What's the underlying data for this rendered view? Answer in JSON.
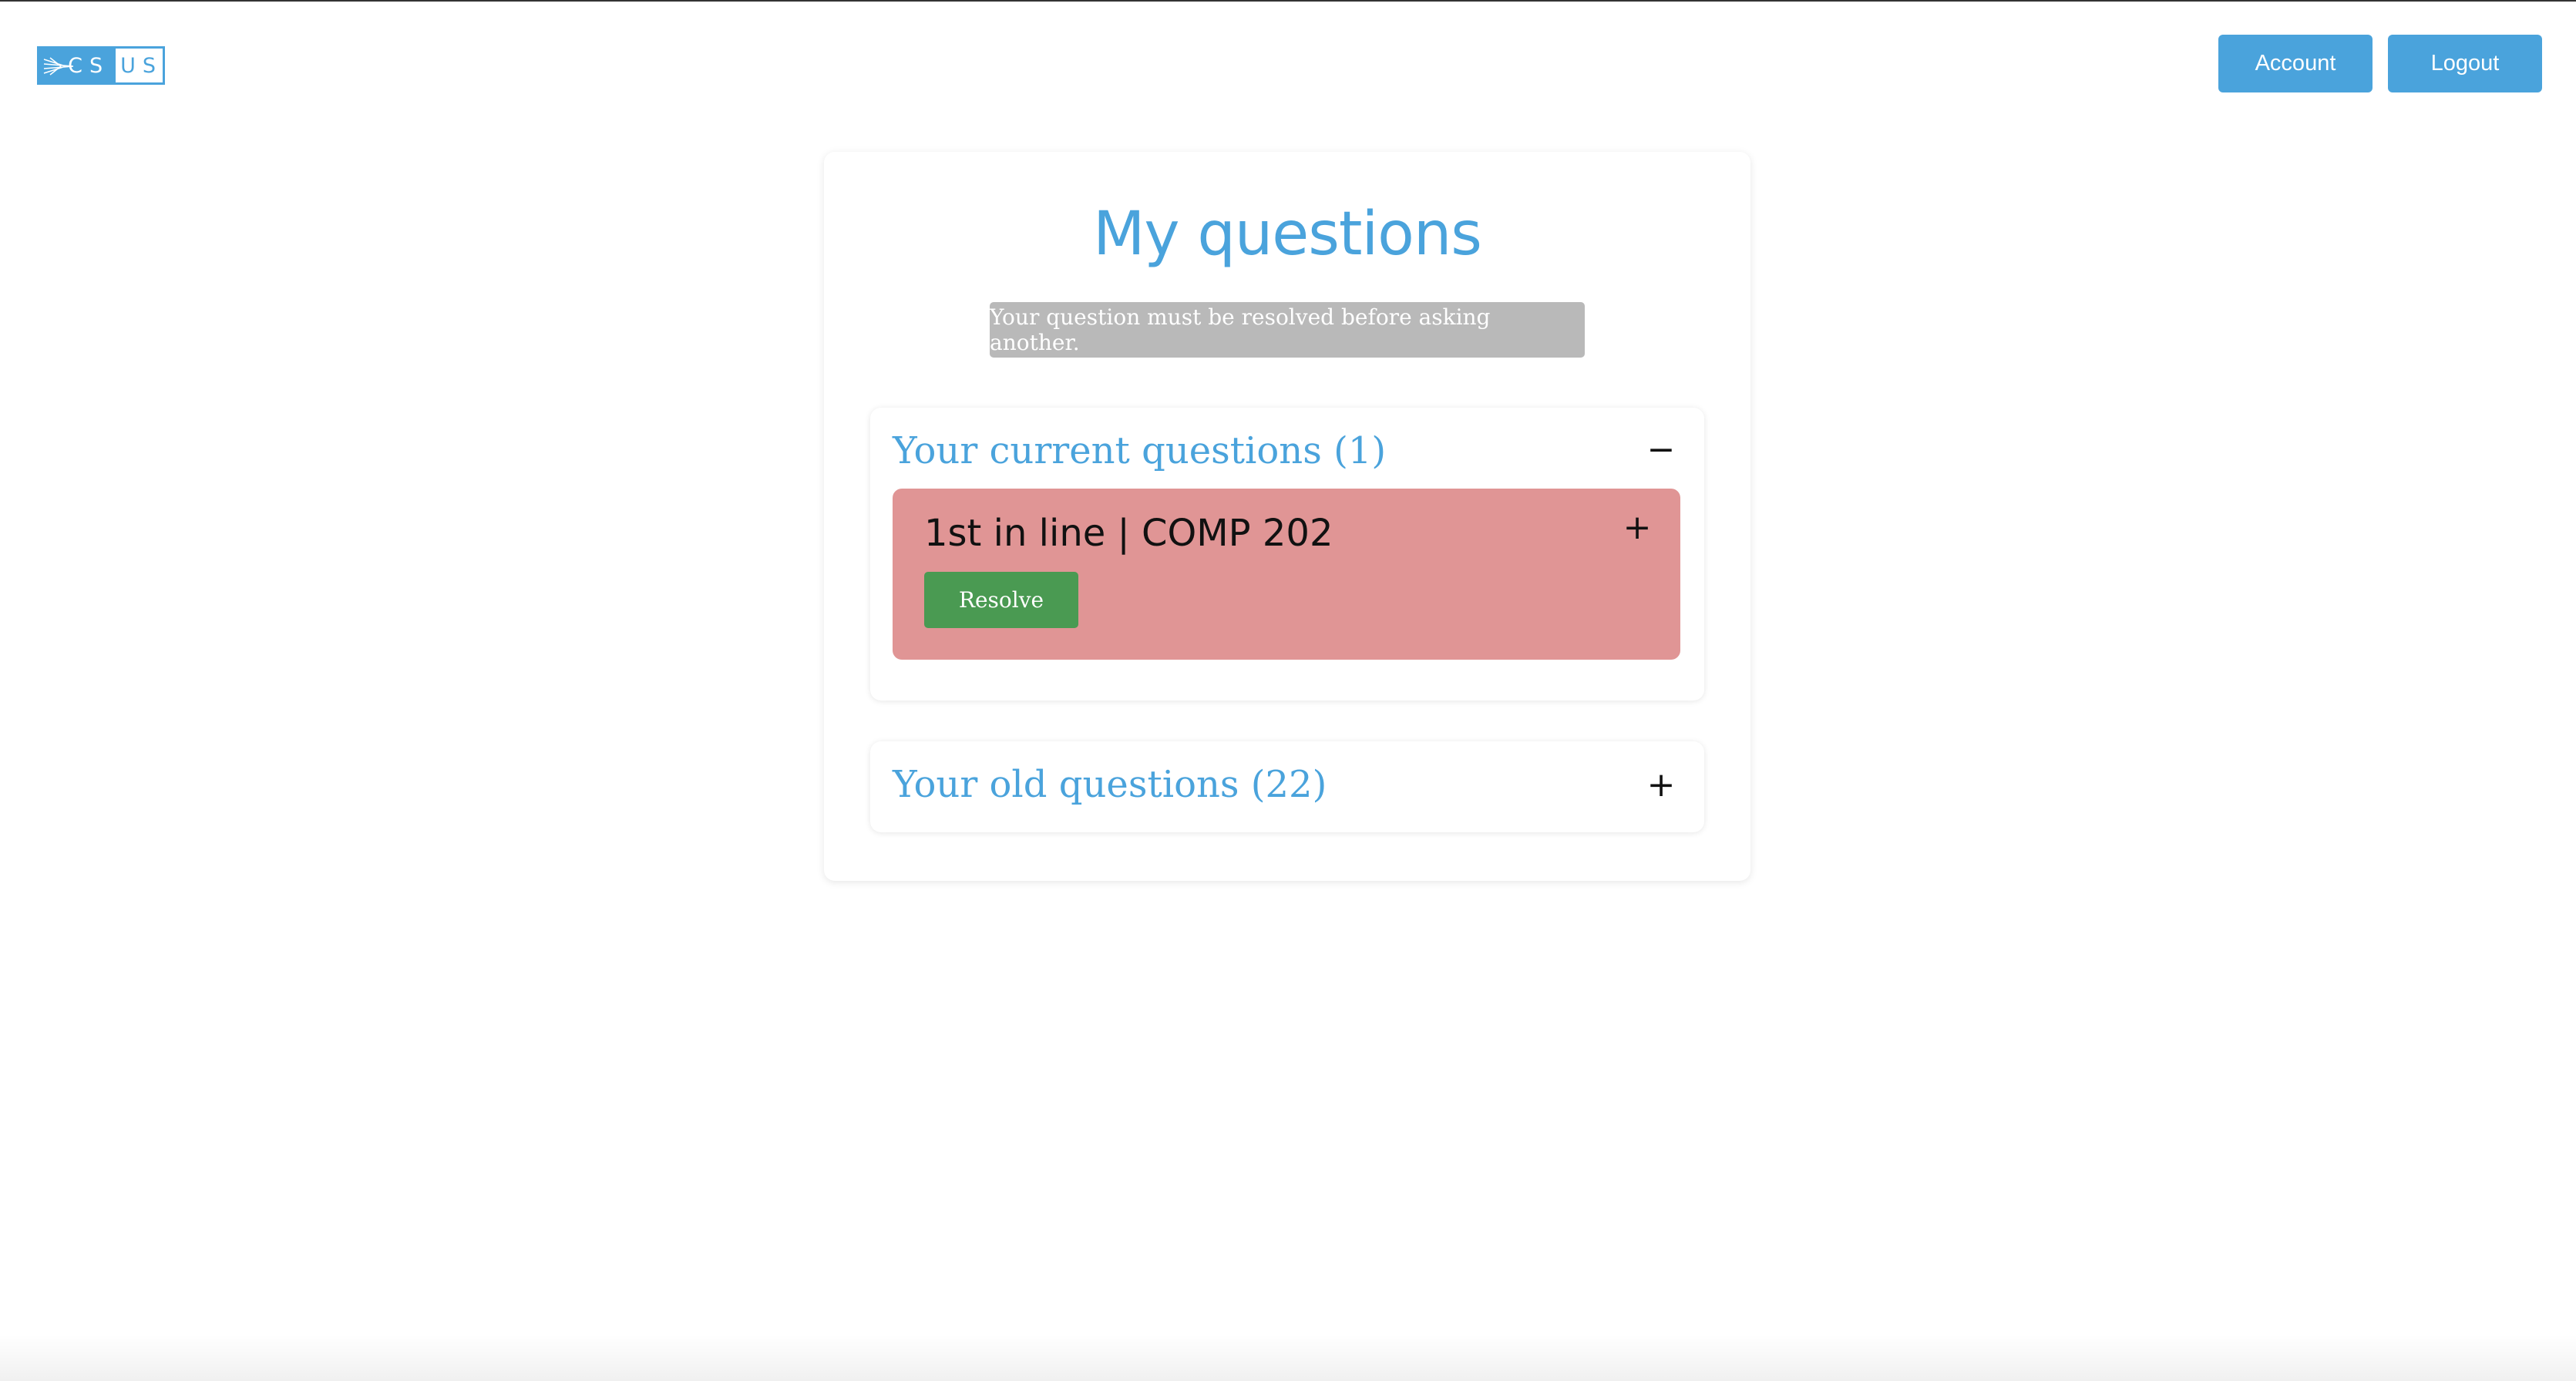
{
  "header": {
    "logo_text_left": "CS",
    "logo_text_right": "US",
    "account_label": "Account",
    "logout_label": "Logout"
  },
  "main": {
    "title": "My questions",
    "notice": "Your question must be resolved before asking another.",
    "current_panel": {
      "title": "Your current questions (1)",
      "toggle_icon": "−",
      "expanded": true,
      "items": [
        {
          "title": "1st in line | COMP 202",
          "expand_icon": "+",
          "resolve_label": "Resolve"
        }
      ]
    },
    "old_panel": {
      "title": "Your old questions (22)",
      "toggle_icon": "+",
      "expanded": false
    }
  },
  "colors": {
    "accent": "#4aa3dc",
    "notice_bg": "#b9b9b9",
    "question_bg": "#e09595",
    "resolve_bg": "#4a9a52"
  }
}
